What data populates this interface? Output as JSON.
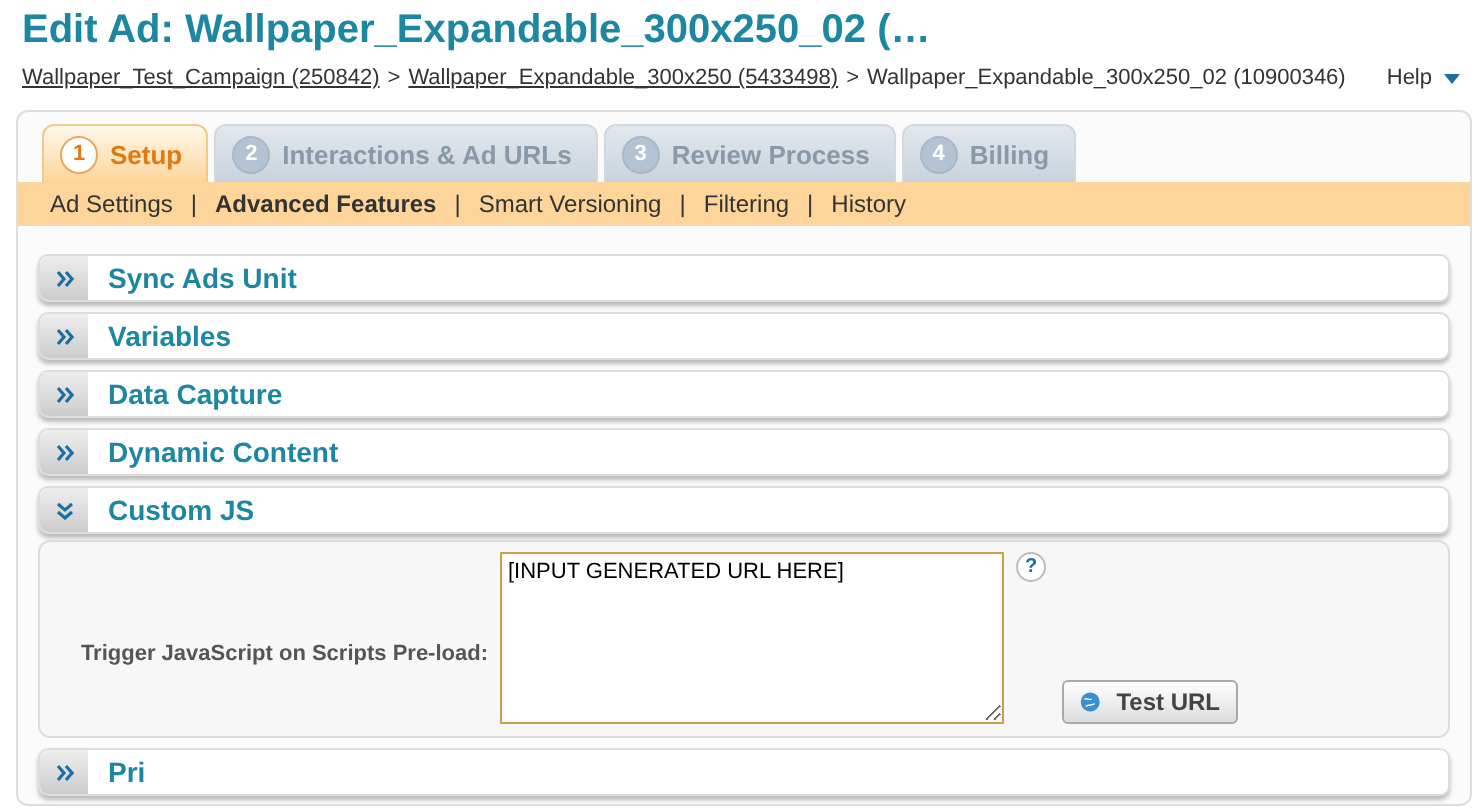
{
  "page_title": "Edit Ad: Wallpaper_Expandable_300x250_02 (…",
  "breadcrumb": [
    {
      "label": "Wallpaper_Test_Campaign (250842)",
      "link": true
    },
    {
      "label": "Wallpaper_Expandable_300x250 (5433498)",
      "link": true
    },
    {
      "label": "Wallpaper_Expandable_300x250_02 (10900346)",
      "link": false
    }
  ],
  "breadcrumb_separator": ">",
  "help": "Help",
  "tabs": [
    {
      "number": "1",
      "label": "Setup",
      "selected": true
    },
    {
      "number": "2",
      "label": "Interactions & Ad URLs",
      "selected": false
    },
    {
      "number": "3",
      "label": "Review Process",
      "selected": false
    },
    {
      "number": "4",
      "label": "Billing",
      "selected": false
    }
  ],
  "subnav": [
    {
      "label": "Ad Settings",
      "selected": false
    },
    {
      "label": "Advanced Features",
      "selected": true
    },
    {
      "label": "Smart Versioning",
      "selected": false
    },
    {
      "label": "Filtering",
      "selected": false
    },
    {
      "label": "History",
      "selected": false
    }
  ],
  "subnav_separator": "|",
  "sections": [
    {
      "title": "Sync Ads Unit",
      "expanded": false
    },
    {
      "title": "Variables",
      "expanded": false
    },
    {
      "title": "Data Capture",
      "expanded": false
    },
    {
      "title": "Dynamic Content",
      "expanded": false
    },
    {
      "title": "Custom JS",
      "expanded": true,
      "field_label": "Trigger JavaScript on Scripts Pre-load:",
      "value": "[INPUT GENERATED URL HERE]",
      "help": "?",
      "button": "Test URL"
    },
    {
      "title": "Pri",
      "expanded": false
    }
  ]
}
